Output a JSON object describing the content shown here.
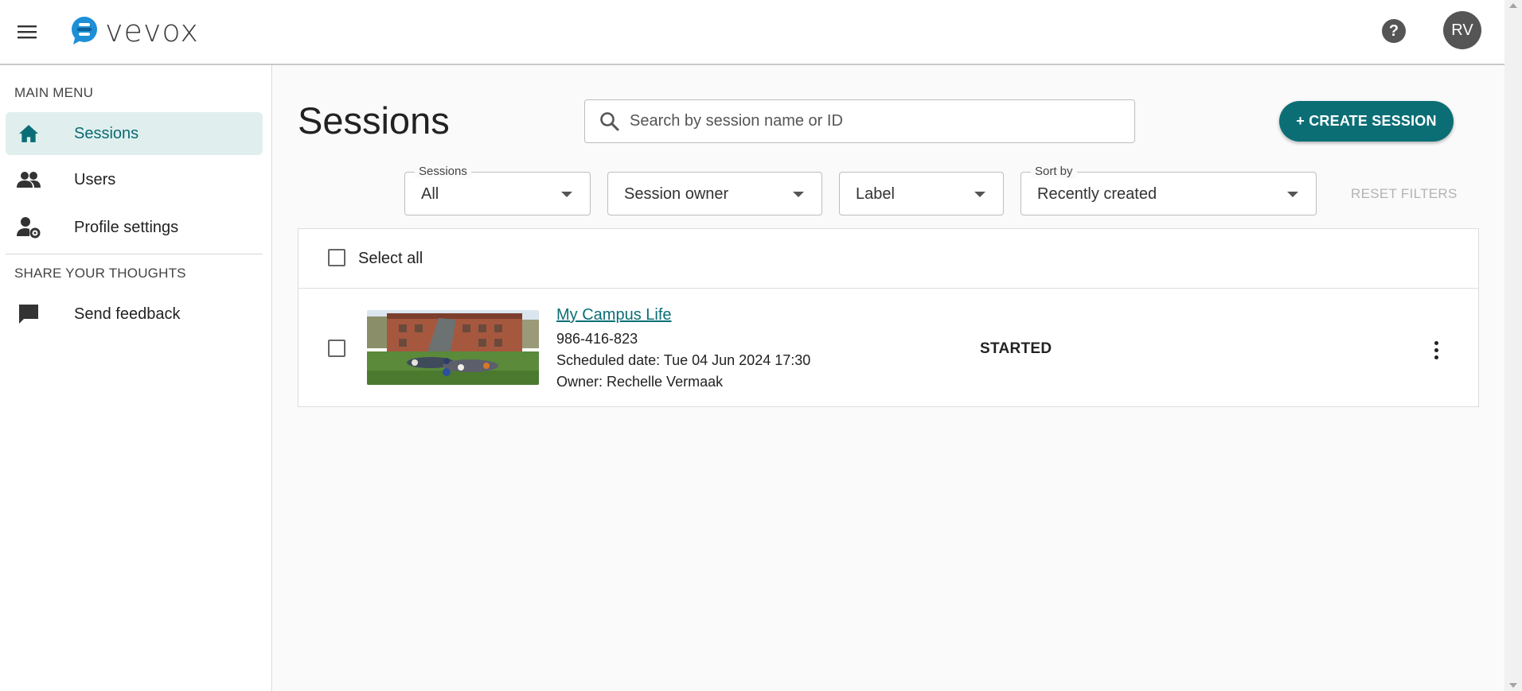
{
  "header": {
    "logo_text": "vevox",
    "help_label": "?",
    "avatar_initials": "RV"
  },
  "sidebar": {
    "main_menu_heading": "MAIN MENU",
    "items": [
      {
        "label": "Sessions",
        "icon": "home-icon",
        "active": true
      },
      {
        "label": "Users",
        "icon": "users-icon"
      },
      {
        "label": "Profile settings",
        "icon": "user-settings-icon"
      }
    ],
    "share_heading": "SHARE YOUR THOUGHTS",
    "feedback_label": "Send feedback"
  },
  "main": {
    "title": "Sessions",
    "search_placeholder": "Search by session name or ID",
    "create_button": "+ CREATE SESSION",
    "filters": {
      "sessions": {
        "label": "Sessions",
        "value": "All"
      },
      "owner": {
        "value": "Session owner"
      },
      "label": {
        "value": "Label"
      },
      "sort": {
        "label": "Sort by",
        "value": "Recently created"
      }
    },
    "reset_filters": "RESET FILTERS",
    "select_all": "Select all",
    "sessions": [
      {
        "title": "My Campus Life",
        "id": "986-416-823",
        "scheduled": "Scheduled date: Tue 04 Jun 2024 17:30",
        "owner": "Owner: Rechelle Vermaak",
        "status": "STARTED"
      }
    ]
  },
  "colors": {
    "accent": "#0b6e75",
    "active_bg": "#e0efee",
    "logo_blue": "#1d8fd6"
  }
}
